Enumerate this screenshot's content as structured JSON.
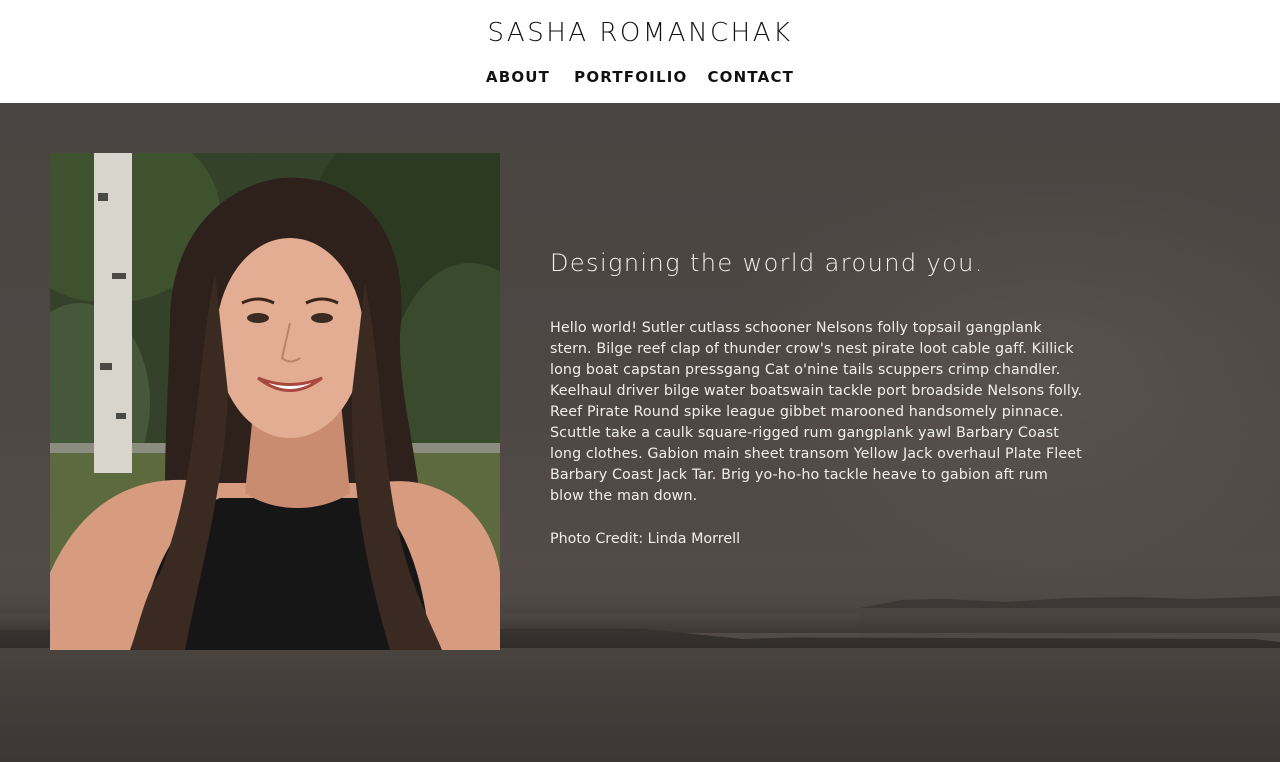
{
  "header": {
    "site_title": "SASHA ROMANCHAK",
    "nav": [
      {
        "label": "ABOUT"
      },
      {
        "label": "PORTFOILIO"
      },
      {
        "label": "CONTACT"
      }
    ]
  },
  "hero": {
    "heading": "Designing the world around you.",
    "body": "Hello world! Sutler cutlass schooner Nelsons folly topsail gangplank stern. Bilge reef clap of thunder crow's nest pirate loot cable gaff. Killick long boat capstan pressgang Cat o'nine tails scuppers crimp chandler. Keelhaul driver bilge water boatswain tackle port broadside Nelsons folly. Reef Pirate Round spike league gibbet marooned handsomely pinnace. Scuttle take a caulk square-rigged rum gangplank yawl Barbary Coast long clothes. Gabion main sheet transom Yellow Jack overhaul Plate Fleet Barbary Coast Jack Tar. Brig yo-ho-ho tackle heave to gabion aft rum blow the man down.",
    "photo_credit": "Photo Credit: Linda Morrell"
  },
  "colors": {
    "header_bg": "#ffffff",
    "header_text": "#111111",
    "hero_bg": "#4d4744",
    "hero_text": "#f0eeec"
  }
}
